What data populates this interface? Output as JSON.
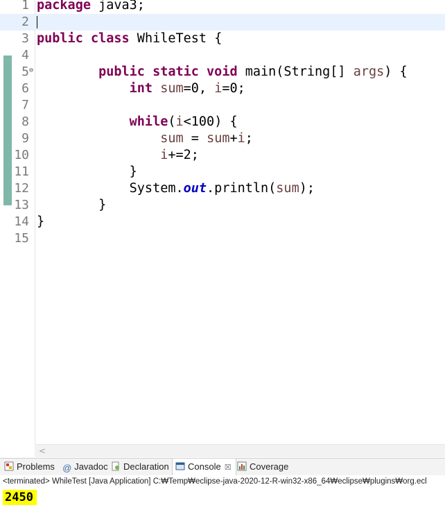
{
  "editor": {
    "lines": [
      {
        "num": "1",
        "tokens": [
          {
            "t": "package",
            "c": "kw"
          },
          {
            "t": " java3;",
            "c": ""
          }
        ]
      },
      {
        "num": "2",
        "tokens": []
      },
      {
        "num": "3",
        "tokens": [
          {
            "t": "public",
            "c": "kw"
          },
          {
            "t": " ",
            "c": ""
          },
          {
            "t": "class",
            "c": "kw"
          },
          {
            "t": " WhileTest {",
            "c": ""
          }
        ]
      },
      {
        "num": "4",
        "tokens": []
      },
      {
        "num": "5",
        "tokens": [
          {
            "t": "        ",
            "c": ""
          },
          {
            "t": "public",
            "c": "kw"
          },
          {
            "t": " ",
            "c": ""
          },
          {
            "t": "static",
            "c": "kw"
          },
          {
            "t": " ",
            "c": ""
          },
          {
            "t": "void",
            "c": "kw"
          },
          {
            "t": " main(String[] ",
            "c": ""
          },
          {
            "t": "args",
            "c": "var"
          },
          {
            "t": ") {",
            "c": ""
          }
        ]
      },
      {
        "num": "6",
        "tokens": [
          {
            "t": "            ",
            "c": ""
          },
          {
            "t": "int",
            "c": "kw"
          },
          {
            "t": " ",
            "c": ""
          },
          {
            "t": "sum",
            "c": "var"
          },
          {
            "t": "=0, ",
            "c": ""
          },
          {
            "t": "i",
            "c": "var"
          },
          {
            "t": "=0;",
            "c": ""
          }
        ]
      },
      {
        "num": "7",
        "tokens": []
      },
      {
        "num": "8",
        "tokens": [
          {
            "t": "            ",
            "c": ""
          },
          {
            "t": "while",
            "c": "kw"
          },
          {
            "t": "(",
            "c": ""
          },
          {
            "t": "i",
            "c": "var"
          },
          {
            "t": "<100) {",
            "c": ""
          }
        ]
      },
      {
        "num": "9",
        "tokens": [
          {
            "t": "                ",
            "c": ""
          },
          {
            "t": "sum",
            "c": "var"
          },
          {
            "t": " = ",
            "c": ""
          },
          {
            "t": "sum",
            "c": "var"
          },
          {
            "t": "+",
            "c": ""
          },
          {
            "t": "i",
            "c": "var"
          },
          {
            "t": ";",
            "c": ""
          }
        ]
      },
      {
        "num": "10",
        "tokens": [
          {
            "t": "                ",
            "c": ""
          },
          {
            "t": "i",
            "c": "var"
          },
          {
            "t": "+=2;",
            "c": ""
          }
        ]
      },
      {
        "num": "11",
        "tokens": [
          {
            "t": "            }",
            "c": ""
          }
        ]
      },
      {
        "num": "12",
        "tokens": [
          {
            "t": "            System.",
            "c": ""
          },
          {
            "t": "out",
            "c": "fld"
          },
          {
            "t": ".println(",
            "c": ""
          },
          {
            "t": "sum",
            "c": "var"
          },
          {
            "t": ");",
            "c": ""
          }
        ]
      },
      {
        "num": "13",
        "tokens": [
          {
            "t": "        }",
            "c": ""
          }
        ]
      },
      {
        "num": "14",
        "tokens": [
          {
            "t": "}",
            "c": ""
          }
        ]
      },
      {
        "num": "15",
        "tokens": []
      }
    ]
  },
  "views": {
    "tabs": [
      {
        "label": "Problems",
        "icon": "problems-icon"
      },
      {
        "label": "Javadoc",
        "icon": "javadoc-icon"
      },
      {
        "label": "Declaration",
        "icon": "declaration-icon"
      },
      {
        "label": "Console",
        "icon": "console-icon",
        "active": true
      },
      {
        "label": "Coverage",
        "icon": "coverage-icon"
      }
    ],
    "javadoc_symbol": "@",
    "close_symbol": "☒"
  },
  "console": {
    "status": "<terminated> WhileTest [Java Application] C:₩Temp₩eclipse-java-2020-12-R-win32-x86_64₩eclipse₩plugins₩org.ecl",
    "output": "2450"
  },
  "colors": {
    "keyword": "#7f0055",
    "variable": "#6a3e3e",
    "field": "#0000c0",
    "highlight": "#ffff00",
    "coverage": "#7fb7a8"
  }
}
